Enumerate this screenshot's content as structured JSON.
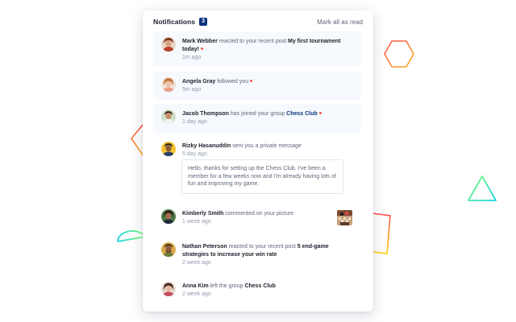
{
  "header": {
    "title": "Notifications",
    "unread_count": "3",
    "mark_all_label": "Mark all as read"
  },
  "colors": {
    "badge": "#0a327b",
    "unread_bg": "#f6f9fd",
    "dot": "#f65552",
    "name_text": "#1c202b",
    "body_text": "#5e6778",
    "time_text": "#939cad"
  },
  "notifications": [
    {
      "name": "Mark Webber",
      "action": " reacted to your recent post ",
      "object": "My first tournament today!",
      "time": "1m ago",
      "unread": true,
      "avatar_icon": "person-avatar"
    },
    {
      "name": "Angela Gray",
      "action": " followed you",
      "time": "5m ago",
      "unread": true,
      "avatar_icon": "person-avatar"
    },
    {
      "name": "Jacob Thompson",
      "action": " has joined your group ",
      "object": "Chess Club",
      "time": "1 day ago",
      "unread": true,
      "avatar_icon": "person-avatar"
    },
    {
      "name": "Rizky Hasanuddin",
      "action": " sent you a private message",
      "time": "5 day ago",
      "unread": false,
      "message": "Hello, thanks for setting up the Chess Club. I've been a member for a few weeks now and I'm already having lots of fun and improving my game.",
      "avatar_icon": "person-avatar"
    },
    {
      "name": "Kimberly Smith",
      "action": " commented on your picture",
      "time": "1 week ago",
      "unread": false,
      "avatar_icon": "person-avatar",
      "thumbnail_icon": "chess-picture-thumbnail"
    },
    {
      "name": "Nathan Peterson",
      "action": " reacted to your recent post ",
      "object": "5 end-game strategies to increase your win rate",
      "time": "2 week ago",
      "unread": false,
      "avatar_icon": "person-avatar"
    },
    {
      "name": "Anna Kim",
      "action": " left the group ",
      "object": "Chess Club",
      "time": "2 week ago",
      "unread": false,
      "avatar_icon": "person-avatar"
    }
  ]
}
